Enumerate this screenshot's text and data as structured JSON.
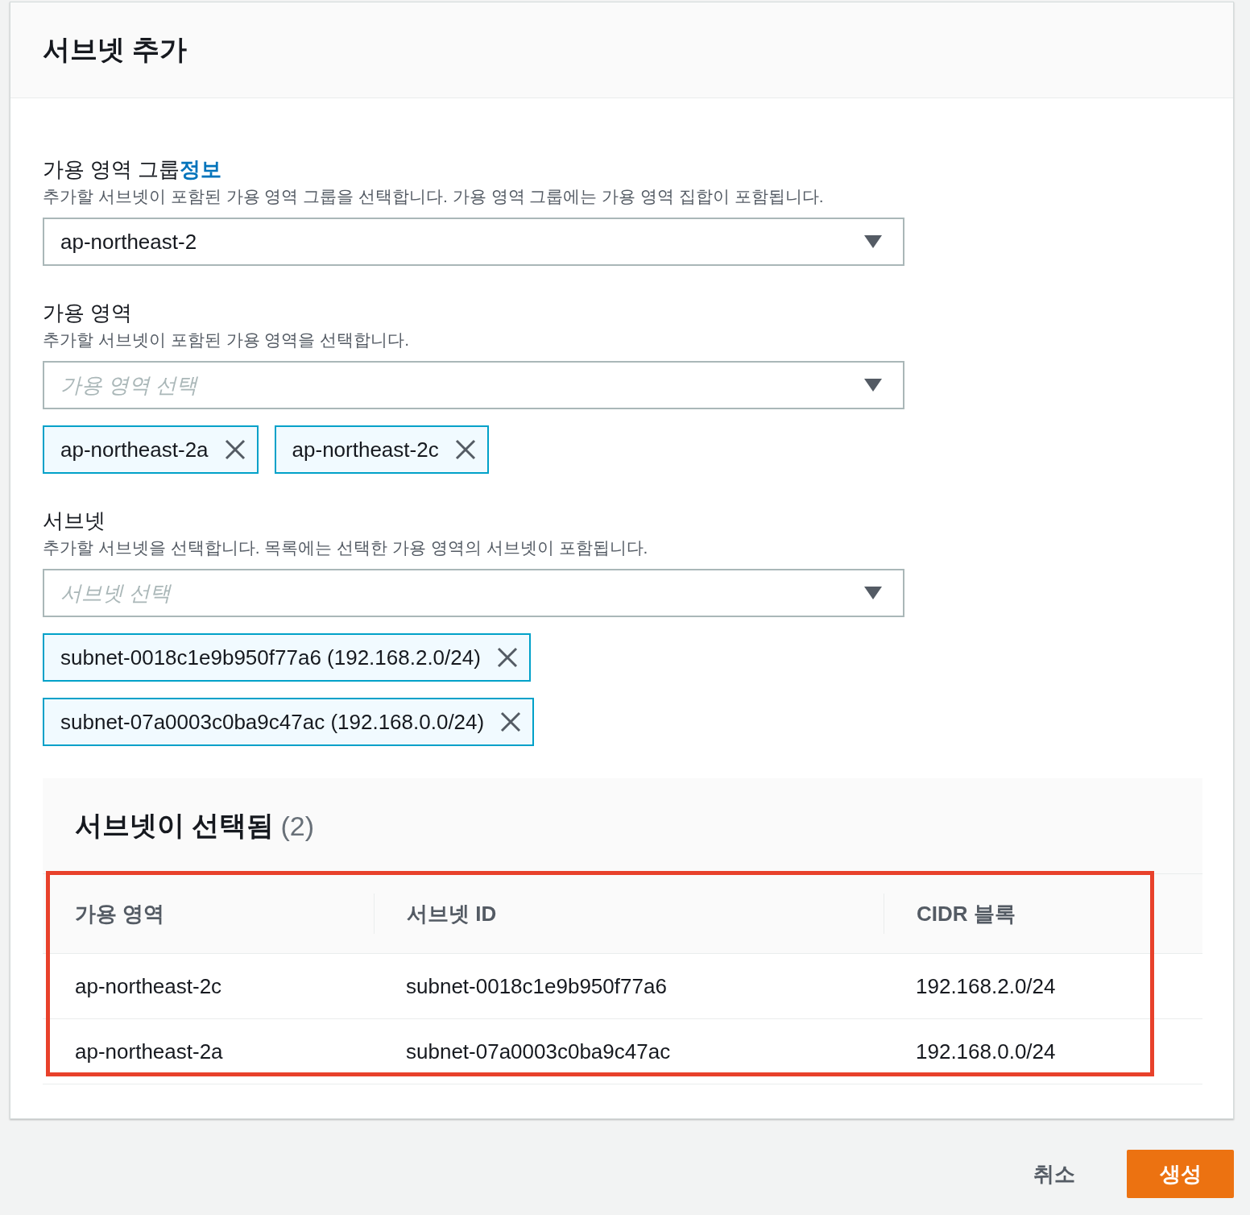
{
  "header": {
    "title": "서브넷 추가"
  },
  "fields": [
    {
      "label": "가용 영역 그룹",
      "info_link": "정보",
      "description": "추가할 서브넷이 포함된 가용 영역 그룹을 선택합니다. 가용 영역 그룹에는 가용 영역 집합이 포함됩니다.",
      "value": "ap-northeast-2"
    },
    {
      "label": "가용 영역",
      "description": "추가할 서브넷이 포함된 가용 영역을 선택합니다.",
      "placeholder": "가용 영역 선택",
      "tokens": [
        "ap-northeast-2a",
        "ap-northeast-2c"
      ],
      "tokens_stacked": false
    },
    {
      "label": "서브넷",
      "description": "추가할 서브넷을 선택합니다. 목록에는 선택한 가용 영역의 서브넷이 포함됩니다.",
      "placeholder": "서브넷 선택",
      "tokens": [
        "subnet-0018c1e9b950f77a6 (192.168.2.0/24)",
        "subnet-07a0003c0ba9c47ac (192.168.0.0/24)"
      ],
      "tokens_stacked": true
    }
  ],
  "selected_table": {
    "title": "서브넷이 선택됨",
    "count": "(2)",
    "highlighted": true,
    "columns": [
      "가용 영역",
      "서브넷 ID",
      "CIDR 블록"
    ],
    "rows": [
      [
        "ap-northeast-2c",
        "subnet-0018c1e9b950f77a6",
        "192.168.2.0/24"
      ],
      [
        "ap-northeast-2a",
        "subnet-07a0003c0ba9c47ac",
        "192.168.0.0/24"
      ]
    ]
  },
  "footer": {
    "cancel": "취소",
    "create": "생성"
  }
}
